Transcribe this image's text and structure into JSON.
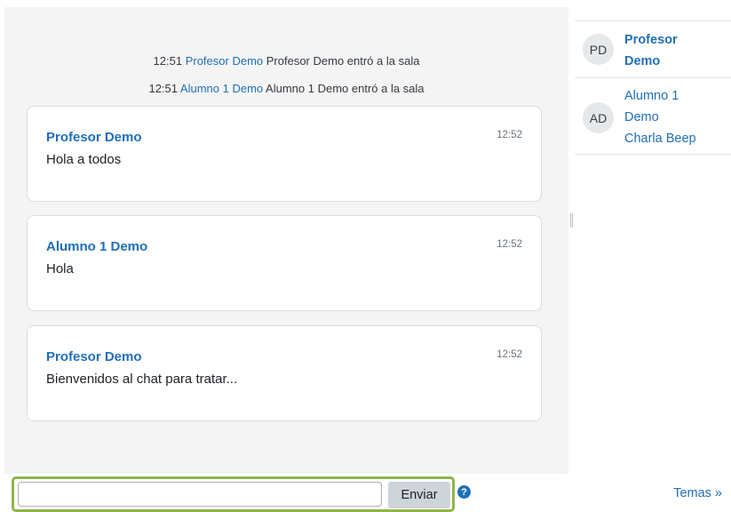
{
  "system_messages": [
    {
      "time": "12:51",
      "user": "Profesor Demo",
      "text": "Profesor Demo entró a la sala"
    },
    {
      "time": "12:51",
      "user": "Alumno 1 Demo",
      "text": "Alumno 1 Demo entró a la sala"
    }
  ],
  "messages": [
    {
      "author": "Profesor Demo",
      "time": "12:52",
      "text": "Hola a todos"
    },
    {
      "author": "Alumno 1 Demo",
      "time": "12:52",
      "text": "Hola"
    },
    {
      "author": "Profesor Demo",
      "time": "12:52",
      "text": "Bienvenidos al chat para tratar..."
    }
  ],
  "users": [
    {
      "initials": "PD",
      "name_line1": "Profesor",
      "name_line2": "Demo",
      "extra": ""
    },
    {
      "initials": "AD",
      "name_line1": "Alumno 1",
      "name_line2": "Demo",
      "extra": "Charla Beep"
    }
  ],
  "composer": {
    "input_value": "",
    "input_placeholder": "",
    "send_label": "Enviar",
    "help_icon": "question-circle-icon",
    "themes_label": "Temas »"
  },
  "colors": {
    "accent": "#1f6fb7",
    "focus_border": "#8fb44a",
    "chat_background": "#f4f4f5"
  }
}
